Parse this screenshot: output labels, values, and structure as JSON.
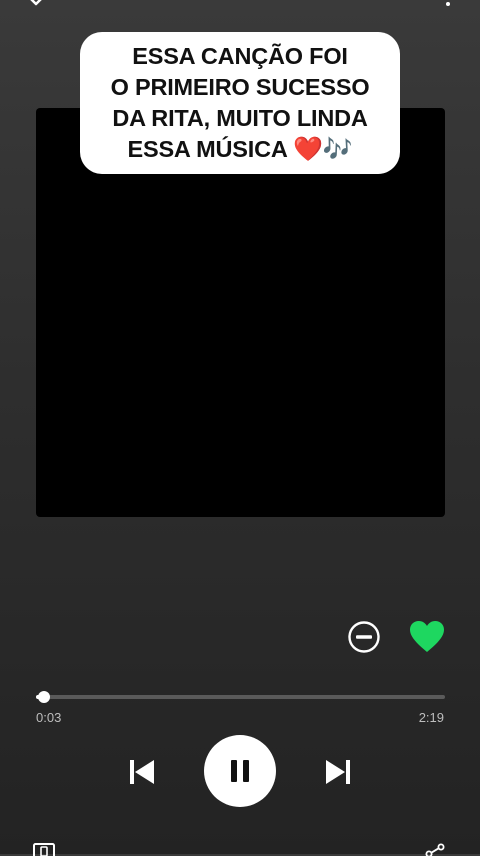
{
  "caption": {
    "lines": [
      "ESSA CANÇÃO FOI",
      "O PRIMEIRO SUCESSO",
      "DA RITA, MUITO LINDA",
      "ESSA MÚSICA"
    ],
    "heart_emoji": "❤️",
    "notes_emoji": "🎶"
  },
  "player": {
    "elapsed": "0:03",
    "total": "2:19",
    "progress_fraction": 0.02,
    "liked": true,
    "state": "playing"
  },
  "colors": {
    "accent_green": "#1ed760",
    "background_top": "#3a3a3a",
    "background_bottom": "#232323"
  },
  "icons": [
    "chevron-down-icon",
    "more-options-icon",
    "hide-song-icon",
    "heart-icon",
    "skip-previous-icon",
    "pause-icon",
    "skip-next-icon",
    "connect-device-icon",
    "share-icon"
  ]
}
